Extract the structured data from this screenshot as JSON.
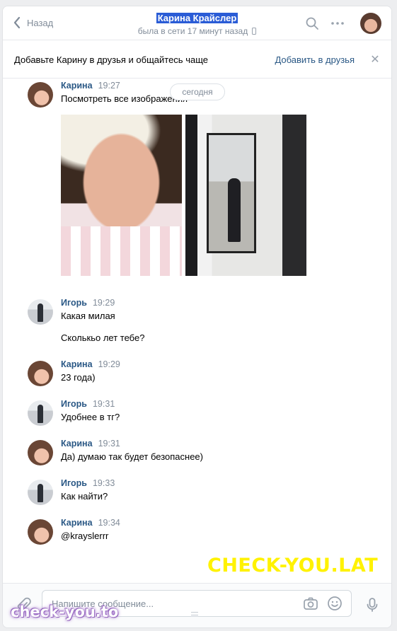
{
  "header": {
    "back_label": "Назад",
    "title": "Карина Крайслер",
    "status": "была в сети 17 минут назад"
  },
  "banner": {
    "text": "Добавьте Карину в друзья и общайтесь чаще",
    "add_label": "Добавить в друзья",
    "close_glyph": "✕"
  },
  "date_separator": "сегодня",
  "messages": [
    {
      "author": "Карина",
      "time": "19:27",
      "lines": [
        "Посмотреть все изображения"
      ]
    },
    {
      "author": "Игорь",
      "time": "19:29",
      "lines": [
        "Какая милая",
        "Сколькьо лет тебе?"
      ]
    },
    {
      "author": "Карина",
      "time": "19:29",
      "lines": [
        "23 года)"
      ]
    },
    {
      "author": "Игорь",
      "time": "19:31",
      "lines": [
        "Удобнее в тг?"
      ]
    },
    {
      "author": "Карина",
      "time": "19:31",
      "lines": [
        "Да) думаю так будет безопаснее)"
      ]
    },
    {
      "author": "Игорь",
      "time": "19:33",
      "lines": [
        "Как найти?"
      ]
    },
    {
      "author": "Карина",
      "time": "19:34",
      "lines": [
        "@krayslerrr"
      ]
    }
  ],
  "composer": {
    "placeholder": "Напишите сообщение..."
  },
  "watermarks": {
    "main": "CHECK-YOU.LAT",
    "corner": "check-you.to"
  },
  "icons": {
    "back": "chevron-left-icon",
    "search": "search-icon",
    "more": "more-dots-icon",
    "attach": "paperclip-icon",
    "camera": "camera-icon",
    "emoji": "smile-icon",
    "mic": "microphone-icon"
  },
  "colors": {
    "link": "#2a5885",
    "muted": "#818c99",
    "title_highlight": "#2a5cd6",
    "watermark_yellow": "#fff200"
  }
}
